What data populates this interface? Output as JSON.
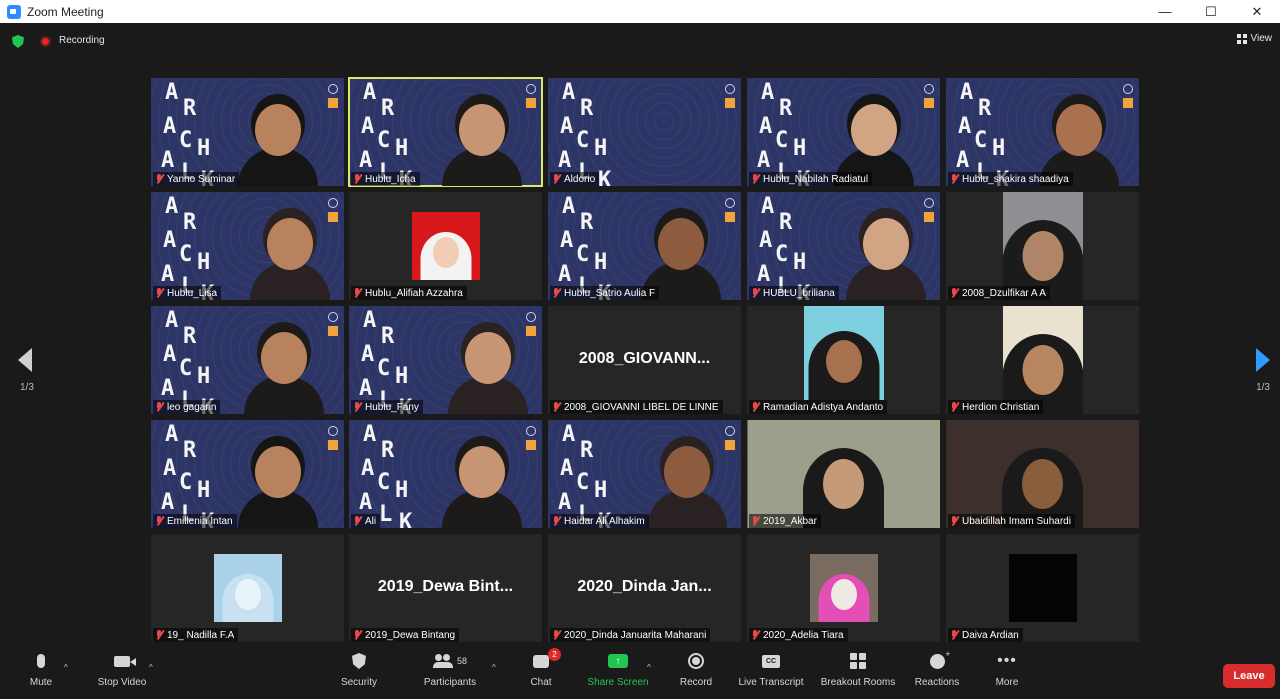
{
  "window": {
    "title": "Zoom Meeting",
    "minimize": "—",
    "maximize": "☐",
    "close": "✕"
  },
  "topbar": {
    "recording_label": "Recording",
    "view_label": "View"
  },
  "pagination": {
    "left": "1/3",
    "right": "1/3"
  },
  "tiles": [
    {
      "name": "Yanno Suminar",
      "kind": "bg"
    },
    {
      "name": "Hublu_Icha",
      "kind": "bg",
      "active": true
    },
    {
      "name": "Aldorio",
      "kind": "bg"
    },
    {
      "name": "Hublu_Nabilah Radiatul",
      "kind": "bg"
    },
    {
      "name": "Hublu_shakira shaadiya",
      "kind": "bg"
    },
    {
      "name": "Hublu_Lisa",
      "kind": "bg"
    },
    {
      "name": "Hublu_Alifiah Azzahra",
      "kind": "photo"
    },
    {
      "name": "Hublu_Satrio Aulia F",
      "kind": "bg"
    },
    {
      "name": "HUBLU_briliana",
      "kind": "bg"
    },
    {
      "name": "2008_Dzulfikar A A",
      "kind": "photo"
    },
    {
      "name": "leo gagarin",
      "kind": "bg"
    },
    {
      "name": "Hublu_Fany",
      "kind": "bg"
    },
    {
      "name": "2008_GIOVANNI LIBEL DE LINNE",
      "kind": "text",
      "big": "2008_GIOVANN..."
    },
    {
      "name": "Ramadian Adistya Andanto",
      "kind": "photo"
    },
    {
      "name": "Herdion Christian",
      "kind": "photo"
    },
    {
      "name": "Emillenia Intan",
      "kind": "bg"
    },
    {
      "name": "Ali",
      "kind": "bg"
    },
    {
      "name": "Haidar Ali Alhakim",
      "kind": "bg"
    },
    {
      "name": "2019_Akbar",
      "kind": "video"
    },
    {
      "name": "Ubaidillah Imam Suhardi",
      "kind": "video"
    },
    {
      "name": "19_ Nadilla F.A",
      "kind": "photo"
    },
    {
      "name": "2019_Dewa Bintang",
      "kind": "text",
      "big": "2019_Dewa  Bint..."
    },
    {
      "name": "2020_Dinda Januarita Maharani",
      "kind": "text",
      "big": "2020_Dinda  Jan..."
    },
    {
      "name": "2020_Adelia Tiara",
      "kind": "photo"
    },
    {
      "name": "Daiva Ardian",
      "kind": "photo"
    }
  ],
  "toolbar": {
    "mute": "Mute",
    "stop_video": "Stop Video",
    "security": "Security",
    "participants": "Participants",
    "participants_count": "58",
    "chat": "Chat",
    "chat_badge": "2",
    "share_screen": "Share Screen",
    "record": "Record",
    "live_transcript": "Live Transcript",
    "cc": "CC",
    "breakout_rooms": "Breakout Rooms",
    "reactions": "Reactions",
    "more": "More",
    "leave": "Leave"
  },
  "colors": {
    "accent_green": "#23c552",
    "leave_red": "#d92d2d",
    "tile_background_blue": "#2d3566",
    "active_speaker": "#d8e86a"
  }
}
